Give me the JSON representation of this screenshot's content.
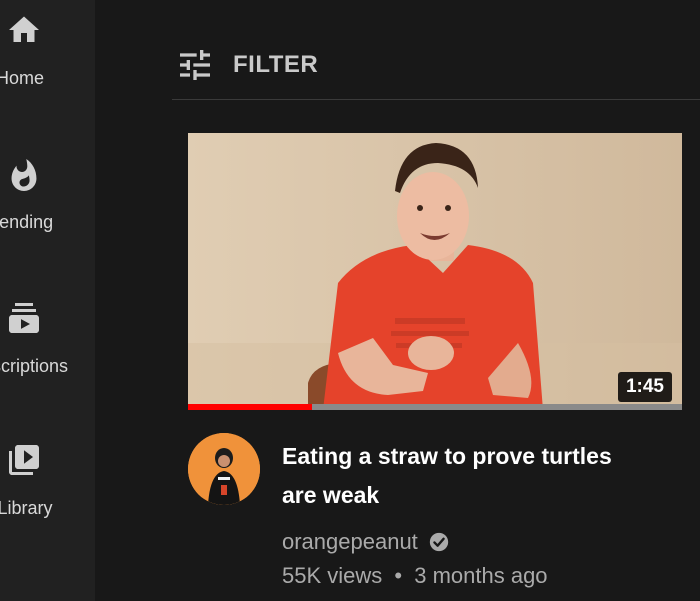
{
  "sidebar": {
    "items": [
      {
        "label": "Home",
        "icon": "home-icon"
      },
      {
        "label": "Trending",
        "icon": "flame-icon"
      },
      {
        "label": "Subscriptions",
        "icon": "subscriptions-icon"
      },
      {
        "label": "Library",
        "icon": "library-icon"
      }
    ]
  },
  "filter": {
    "label": "FILTER",
    "icon": "filter-sliders-icon"
  },
  "video": {
    "duration": "1:45",
    "progress": 0.25,
    "title": "Eating a straw to prove turtles are weak",
    "channel": "orangepeanut",
    "verified_icon": "verified-check-icon",
    "views": "55K views",
    "separator": "•",
    "age": "3 months ago"
  },
  "colors": {
    "background": "#181818",
    "sidebar": "#212121",
    "progress": "#ff0000",
    "avatar_bg": "#f0923a",
    "muted_text": "#aaaaaa"
  }
}
